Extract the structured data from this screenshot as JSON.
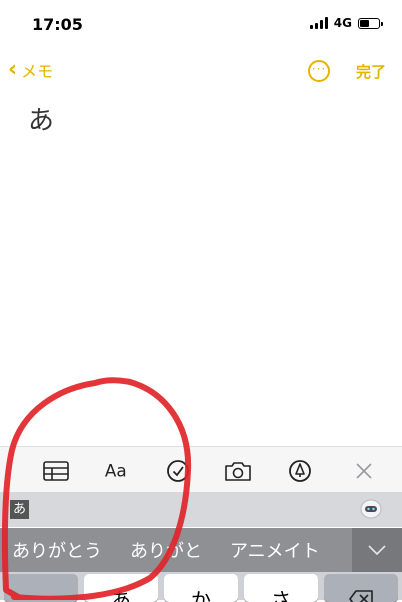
{
  "status": {
    "time": "17:05",
    "network": "4G"
  },
  "nav": {
    "back_label": "メモ",
    "done_label": "完了"
  },
  "note": {
    "body": "あ"
  },
  "ime": {
    "preview": "あ",
    "candidates": [
      "ありがとう",
      "ありがと",
      "アニメイト"
    ]
  },
  "keyboard": {
    "keys": [
      "あ",
      "か",
      "さ"
    ]
  },
  "colors": {
    "accent": "#e5b400",
    "annotation": "#e0252a"
  },
  "icons": [
    "table-icon",
    "text-format-icon",
    "checklist-icon",
    "camera-icon",
    "markup-pen-icon",
    "close-icon",
    "chevron-down-icon",
    "delete-icon"
  ]
}
